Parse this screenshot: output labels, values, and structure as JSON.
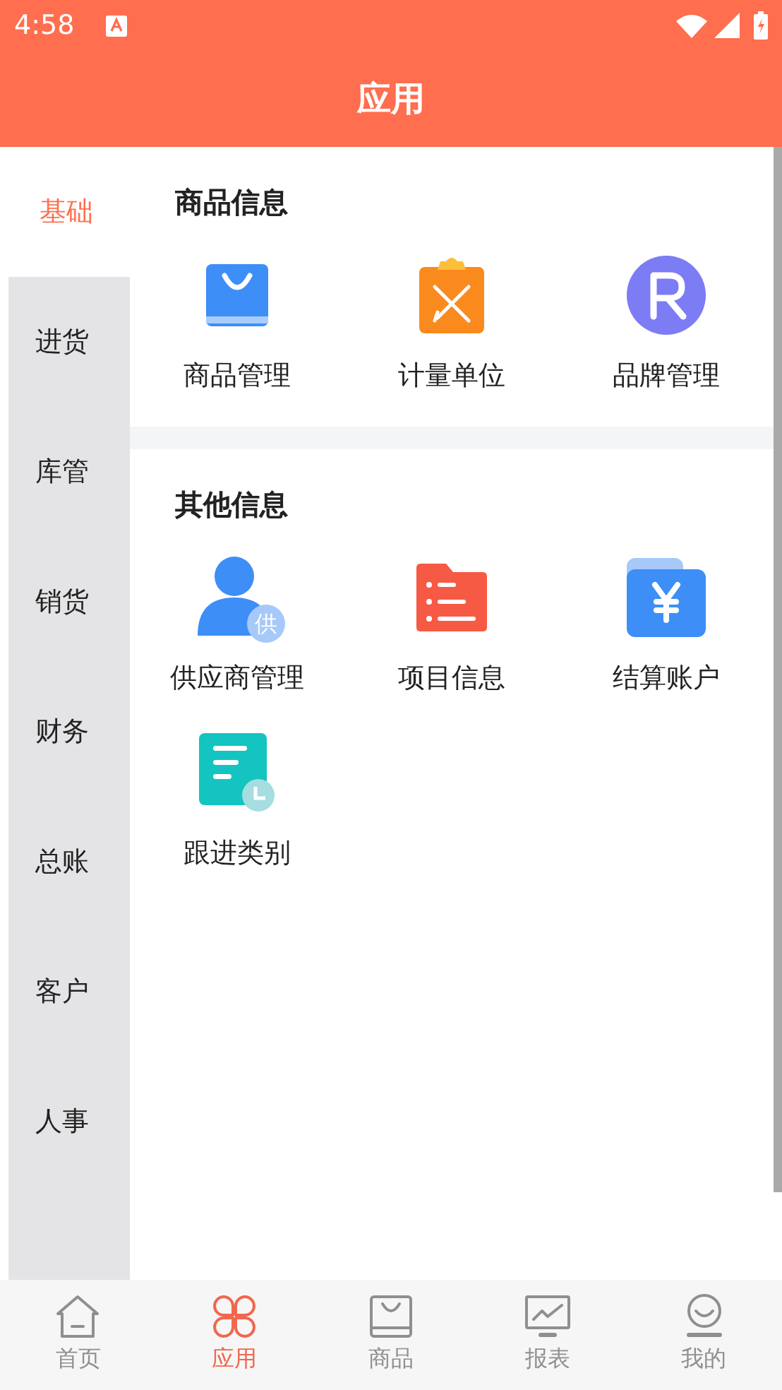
{
  "status_bar": {
    "time": "4:58"
  },
  "header": {
    "title": "应用"
  },
  "sidebar": {
    "items": [
      {
        "label": "基础",
        "selected": true
      },
      {
        "label": "进货",
        "selected": false
      },
      {
        "label": "库管",
        "selected": false
      },
      {
        "label": "销货",
        "selected": false
      },
      {
        "label": "财务",
        "selected": false
      },
      {
        "label": "总账",
        "selected": false
      },
      {
        "label": "客户",
        "selected": false
      },
      {
        "label": "人事",
        "selected": false
      }
    ]
  },
  "sections": [
    {
      "title": "商品信息",
      "items": [
        {
          "kind": "bag",
          "label": "商品管理"
        },
        {
          "kind": "clipboard",
          "label": "计量单位"
        },
        {
          "kind": "brand",
          "label": "品牌管理"
        }
      ]
    },
    {
      "title": "其他信息",
      "items": [
        {
          "kind": "supplier",
          "label": "供应商管理",
          "badge": "供"
        },
        {
          "kind": "folder",
          "label": "项目信息"
        },
        {
          "kind": "wallet",
          "label": "结算账户"
        },
        {
          "kind": "followup",
          "label": "跟进类别"
        }
      ]
    }
  ],
  "bottom_nav": [
    {
      "kind": "home",
      "label": "首页",
      "selected": false
    },
    {
      "kind": "apps",
      "label": "应用",
      "selected": true
    },
    {
      "kind": "goods",
      "label": "商品",
      "selected": false
    },
    {
      "kind": "report",
      "label": "报表",
      "selected": false
    },
    {
      "kind": "me",
      "label": "我的",
      "selected": false
    }
  ]
}
